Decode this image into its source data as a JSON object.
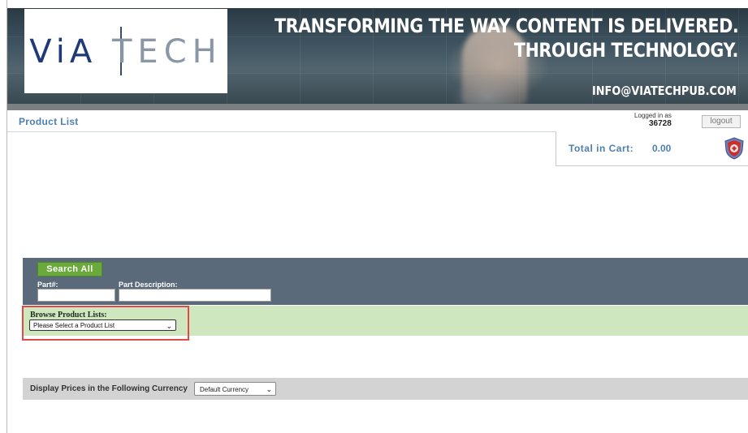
{
  "banner": {
    "logo_part1": "ViA",
    "logo_part2": "TECH",
    "tagline_line1": "TRANSFORMING THE WAY CONTENT IS DELIVERED.",
    "tagline_line2": "THROUGH TECHNOLOGY.",
    "email": "INFO@VIATECHPUB.COM"
  },
  "nav": {
    "title": "Product List",
    "logged_in_label": "Logged in as",
    "user_id": "36728",
    "logout_label": "logout"
  },
  "cart": {
    "label": "Total in Cart:",
    "value": "0.00",
    "icon": "cart-shield-icon"
  },
  "search": {
    "button_label": "Search All",
    "part_label": "Part#:",
    "description_label": "Part Description:",
    "part_value": "",
    "description_value": ""
  },
  "browse": {
    "label": "Browse Product Lists:",
    "selected": "Please Select a Product List"
  },
  "currency": {
    "label": "Display Prices in the Following Currency",
    "selected": "Default Currency"
  },
  "colors": {
    "nav_text": "#4d7fb0",
    "search_panel": "#5a6a7a",
    "search_button": "#6aaa3a",
    "browse_bar": "#cfe7bf",
    "currency_bar": "#d3d3d3",
    "highlight_box": "#e24a4a"
  }
}
